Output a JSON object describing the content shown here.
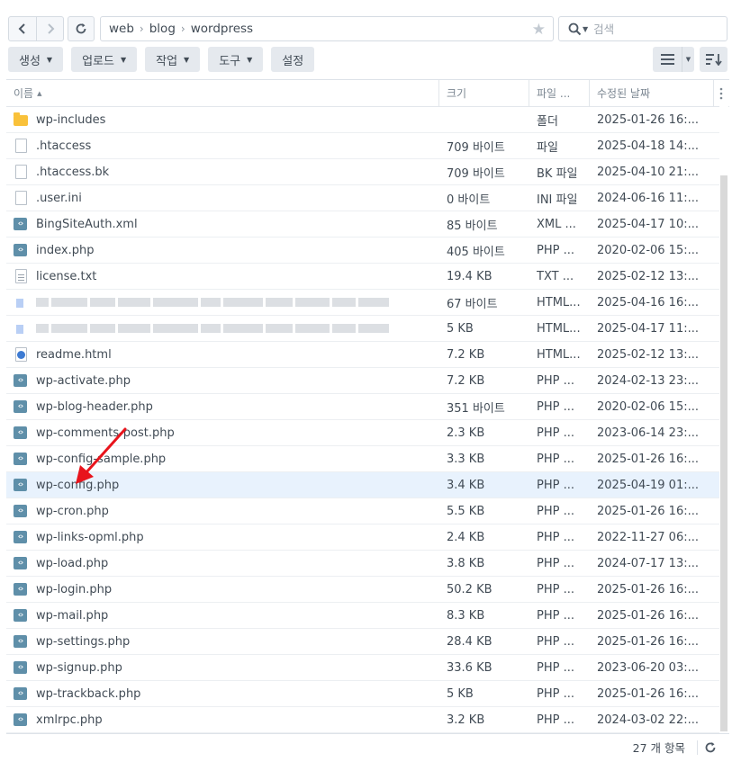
{
  "toolbar": {
    "back_icon": "chevron-left-icon",
    "forward_icon": "chevron-right-icon",
    "refresh_icon": "refresh-icon",
    "path": [
      "web",
      "blog",
      "wordpress"
    ],
    "favorite_icon": "star-icon",
    "search_placeholder": "검색"
  },
  "actions": [
    {
      "label": "생성",
      "dropdown": true
    },
    {
      "label": "업로드",
      "dropdown": true
    },
    {
      "label": "작업",
      "dropdown": true
    },
    {
      "label": "도구",
      "dropdown": true
    },
    {
      "label": "설정",
      "dropdown": false
    }
  ],
  "columns": {
    "name": "이름",
    "size": "크기",
    "type": "파일 ...",
    "modified": "수정된 날짜"
  },
  "files": [
    {
      "name": "wp-includes",
      "size": "",
      "type": "폴더",
      "modified": "2025-01-26 16:...",
      "icon": "folder"
    },
    {
      "name": ".htaccess",
      "size": "709 바이트",
      "type": "파일",
      "modified": "2025-04-18 14:...",
      "icon": "file"
    },
    {
      "name": ".htaccess.bk",
      "size": "709 바이트",
      "type": "BK 파일",
      "modified": "2025-04-10 21:...",
      "icon": "file"
    },
    {
      "name": ".user.ini",
      "size": "0 바이트",
      "type": "INI 파일",
      "modified": "2024-06-16 11:...",
      "icon": "file"
    },
    {
      "name": "BingSiteAuth.xml",
      "size": "85 바이트",
      "type": "XML ...",
      "modified": "2025-04-17 10:...",
      "icon": "code"
    },
    {
      "name": "index.php",
      "size": "405 바이트",
      "type": "PHP ...",
      "modified": "2020-02-06 15:...",
      "icon": "code"
    },
    {
      "name": "license.txt",
      "size": "19.4 KB",
      "type": "TXT ...",
      "modified": "2025-02-12 13:...",
      "icon": "txt"
    },
    {
      "name": "",
      "size": "67 바이트",
      "type": "HTML...",
      "modified": "2025-04-16 16:...",
      "icon": "blur"
    },
    {
      "name": "",
      "size": "5 KB",
      "type": "HTML...",
      "modified": "2025-04-17 11:...",
      "icon": "blur"
    },
    {
      "name": "readme.html",
      "size": "7.2 KB",
      "type": "HTML...",
      "modified": "2025-02-12 13:...",
      "icon": "html"
    },
    {
      "name": "wp-activate.php",
      "size": "7.2 KB",
      "type": "PHP ...",
      "modified": "2024-02-13 23:...",
      "icon": "code"
    },
    {
      "name": "wp-blog-header.php",
      "size": "351 바이트",
      "type": "PHP ...",
      "modified": "2020-02-06 15:...",
      "icon": "code"
    },
    {
      "name": "wp-comments-post.php",
      "size": "2.3 KB",
      "type": "PHP ...",
      "modified": "2023-06-14 23:...",
      "icon": "code"
    },
    {
      "name": "wp-config-sample.php",
      "size": "3.3 KB",
      "type": "PHP ...",
      "modified": "2025-01-26 16:...",
      "icon": "code"
    },
    {
      "name": "wp-config.php",
      "size": "3.4 KB",
      "type": "PHP ...",
      "modified": "2025-04-19 01:...",
      "icon": "code",
      "selected": true
    },
    {
      "name": "wp-cron.php",
      "size": "5.5 KB",
      "type": "PHP ...",
      "modified": "2025-01-26 16:...",
      "icon": "code"
    },
    {
      "name": "wp-links-opml.php",
      "size": "2.4 KB",
      "type": "PHP ...",
      "modified": "2022-11-27 06:...",
      "icon": "code"
    },
    {
      "name": "wp-load.php",
      "size": "3.8 KB",
      "type": "PHP ...",
      "modified": "2024-07-17 13:...",
      "icon": "code"
    },
    {
      "name": "wp-login.php",
      "size": "50.2 KB",
      "type": "PHP ...",
      "modified": "2025-01-26 16:...",
      "icon": "code"
    },
    {
      "name": "wp-mail.php",
      "size": "8.3 KB",
      "type": "PHP ...",
      "modified": "2025-01-26 16:...",
      "icon": "code"
    },
    {
      "name": "wp-settings.php",
      "size": "28.4 KB",
      "type": "PHP ...",
      "modified": "2025-01-26 16:...",
      "icon": "code"
    },
    {
      "name": "wp-signup.php",
      "size": "33.6 KB",
      "type": "PHP ...",
      "modified": "2023-06-20 03:...",
      "icon": "code"
    },
    {
      "name": "wp-trackback.php",
      "size": "5 KB",
      "type": "PHP ...",
      "modified": "2025-01-26 16:...",
      "icon": "code"
    },
    {
      "name": "xmlrpc.php",
      "size": "3.2 KB",
      "type": "PHP ...",
      "modified": "2024-03-02 22:...",
      "icon": "code"
    }
  ],
  "footer": {
    "item_count": "27 개 항목",
    "refresh_icon": "refresh-icon"
  },
  "annotation": {
    "arrow_color": "#e8141c",
    "target": "wp-config.php"
  },
  "colors": {
    "selected_row": "#e8f2fd",
    "folder": "#f9c13a",
    "code_icon": "#5f8fa9",
    "html_icon": "#3d7bd3"
  }
}
